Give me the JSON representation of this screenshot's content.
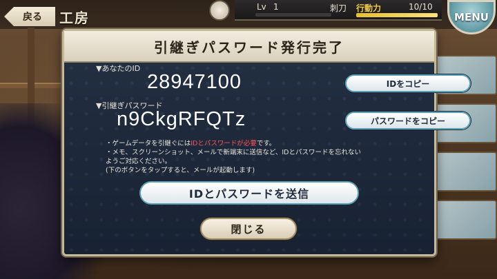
{
  "topbar": {
    "back_label": "戻る",
    "page_title": "工房",
    "level_label": "Lv",
    "level_value": "1",
    "unit_name": "刺刀",
    "ap_label": "行動力",
    "ap_value": "10/10",
    "ap_fraction": 1.0,
    "menu_label": "MENU"
  },
  "dialog": {
    "title": "引継ぎパスワード発行完了",
    "id_label": "▼あなたのID",
    "id_value": "28947100",
    "copy_id_label": "IDをコピー",
    "password_label": "▼引継ぎパスワード",
    "password_value": "n9CkgRFQTz",
    "copy_password_label": "パスワードをコピー",
    "notes": {
      "line1_prefix": "・ゲームデータを引継ぐには",
      "line1_highlight": "IDとパスワードが必要",
      "line1_suffix": "です。",
      "line2": "・メモ、スクリーンショット、メールで新端末に送信など、IDとパスワードを忘れない",
      "line3": "ようご対応ください。",
      "line4": "(下のボタンをタップすると、メールが起動します)"
    },
    "send_label": "IDとパスワードを送信",
    "close_label": "閉じる"
  },
  "colors": {
    "dialog_bg": "#1d2a3e",
    "header_bg": "#f2ede0",
    "highlight": "#ff5252",
    "ap_gauge": "#e7c031"
  }
}
